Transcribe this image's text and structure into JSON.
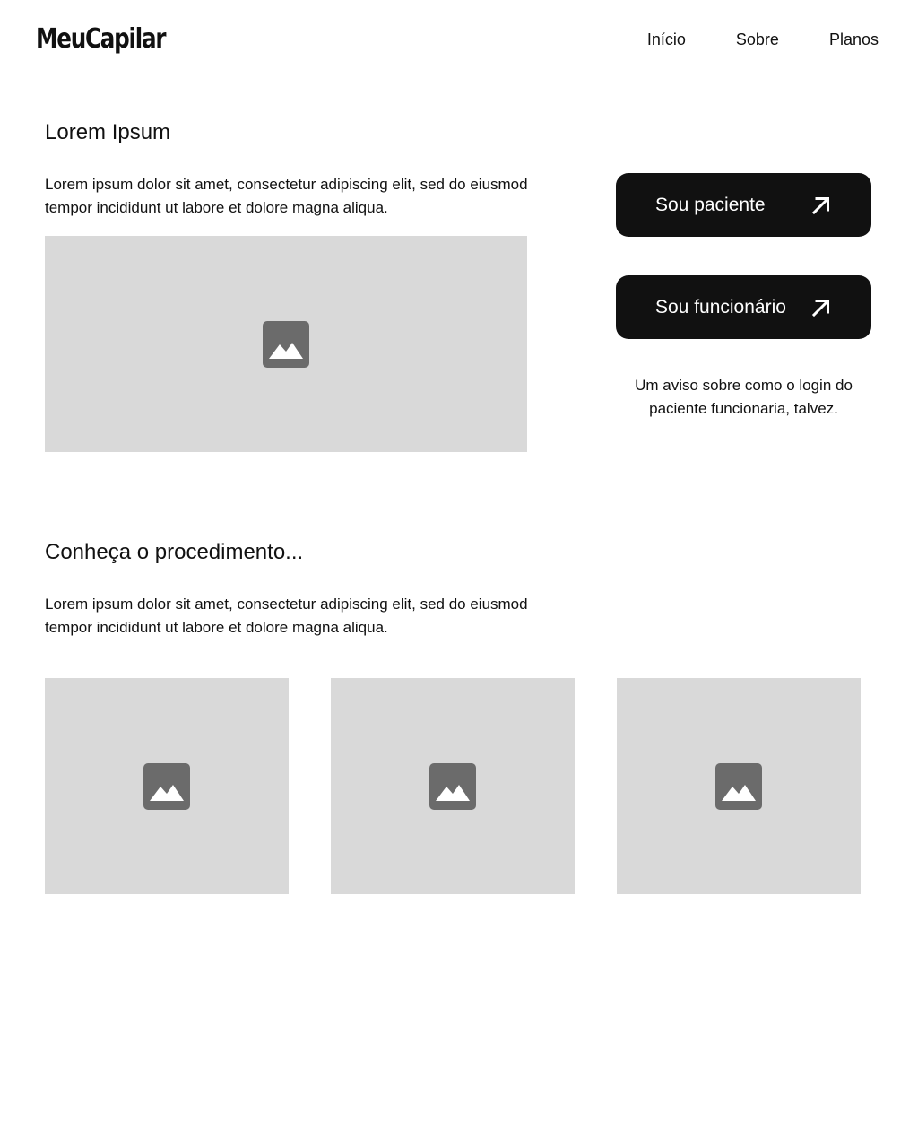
{
  "header": {
    "logo": "MeuCapilar",
    "nav": [
      {
        "label": "Início"
      },
      {
        "label": "Sobre"
      },
      {
        "label": "Planos"
      }
    ]
  },
  "hero": {
    "title": "Lorem Ipsum",
    "text": "Lorem ipsum dolor sit amet, consectetur adipiscing elit, sed do eiusmod tempor incididunt ut labore et dolore magna aliqua.",
    "image_icon": "image-placeholder-icon"
  },
  "login": {
    "patient_button": "Sou paciente",
    "staff_button": "Sou funcionário",
    "button_icon": "arrow-up-right-icon",
    "notice": "Um aviso sobre como o login do paciente funcionaria, talvez."
  },
  "procedure": {
    "title": "Conheça o procedimento...",
    "text": "Lorem ipsum dolor sit amet, consectetur adipiscing elit, sed do eiusmod tempor incididunt ut labore et dolore magna aliqua.",
    "gallery_icon": "image-placeholder-icon"
  },
  "colors": {
    "text": "#111111",
    "button_bg": "#111111",
    "button_text": "#ffffff",
    "placeholder_bg": "#d9d9d9",
    "placeholder_icon": "#6b6b6b",
    "divider": "#c8c8c8"
  }
}
